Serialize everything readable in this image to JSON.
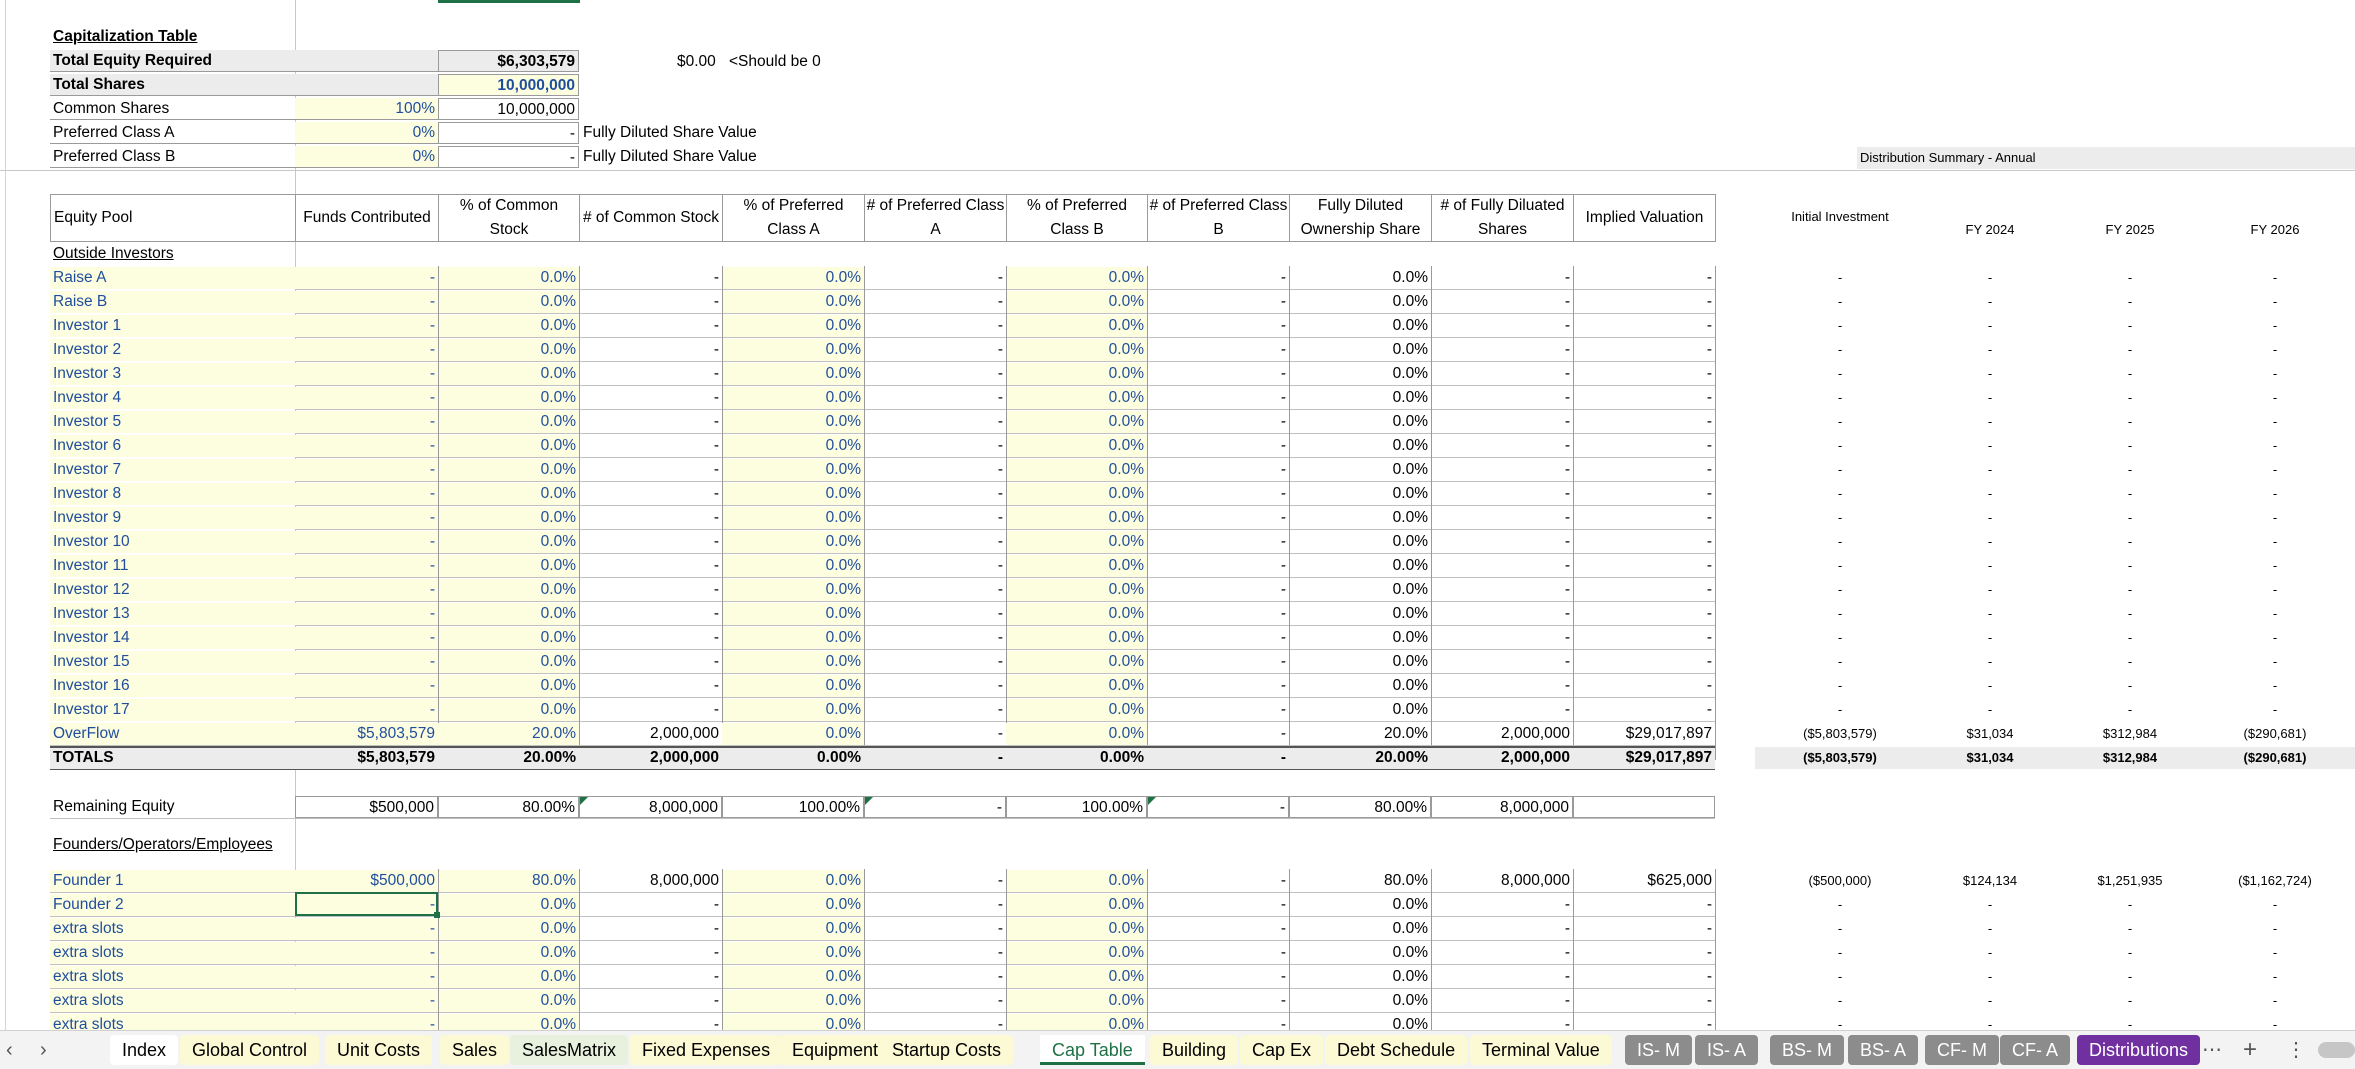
{
  "sheet": {
    "title": "Capitalization Table",
    "summary": [
      {
        "label": "Total Equity Required",
        "pct": "",
        "value": "$6,303,579",
        "note": ""
      },
      {
        "label": "Total Shares",
        "pct": "",
        "value": "10,000,000",
        "note": ""
      },
      {
        "label": "Common Shares",
        "pct": "100%",
        "value": "10,000,000",
        "note": ""
      },
      {
        "label": "Preferred Class A",
        "pct": "0%",
        "value": "-",
        "note": "Fully Diluted Share Value"
      },
      {
        "label": "Preferred Class B",
        "pct": "0%",
        "value": "-",
        "note": "Fully Diluted Share Value"
      }
    ],
    "check_value": "$0.00",
    "check_note": "<Should be 0",
    "dist_title": "Distribution Summary - Annual",
    "headers": [
      "Equity Pool",
      "Funds Contributed",
      "% of Common Stock",
      "# of Common Stock",
      "% of Preferred Class A",
      "# of Preferred Class A",
      "% of Preferred Class B",
      "# of Preferred Class B",
      "Fully Diluted Ownership Share",
      "# of Fully Diluated Shares",
      "Implied Valuation"
    ],
    "dist_headers": [
      "Initial Investment",
      "FY 2024",
      "FY 2025",
      "FY 2026"
    ],
    "outside_label": "Outside Investors",
    "investors": [
      "Raise A",
      "Raise B",
      "Investor 1",
      "Investor 2",
      "Investor 3",
      "Investor 4",
      "Investor 5",
      "Investor 6",
      "Investor 7",
      "Investor 8",
      "Investor 9",
      "Investor 10",
      "Investor 11",
      "Investor 12",
      "Investor 13",
      "Investor 14",
      "Investor 15",
      "Investor 16",
      "Investor 17"
    ],
    "investor_values": [
      "-",
      "0.0%",
      "-",
      "0.0%",
      "-",
      "0.0%",
      "-",
      "0.0%",
      "-",
      "-"
    ],
    "investor_dist": [
      "-",
      "-",
      "-",
      "-"
    ],
    "overflow": {
      "label": "OverFlow",
      "values": [
        "$5,803,579",
        "20.0%",
        "2,000,000",
        "0.0%",
        "-",
        "0.0%",
        "-",
        "20.0%",
        "2,000,000",
        "$29,017,897"
      ],
      "dist": [
        "($5,803,579)",
        "$31,034",
        "$312,984",
        "($290,681)"
      ]
    },
    "totals": {
      "label": "TOTALS",
      "values": [
        "$5,803,579",
        "20.00%",
        "2,000,000",
        "0.00%",
        "-",
        "0.00%",
        "-",
        "20.00%",
        "2,000,000",
        "$29,017,897"
      ],
      "dist": [
        "($5,803,579)",
        "$31,034",
        "$312,984",
        "($290,681)"
      ]
    },
    "remaining": {
      "label": "Remaining Equity",
      "values": [
        "$500,000",
        "80.00%",
        "8,000,000",
        "100.00%",
        "-",
        "100.00%",
        "-",
        "80.00%",
        "8,000,000",
        ""
      ]
    },
    "founders_label": "Founders/Operators/Employees",
    "founders": [
      {
        "label": "Founder 1",
        "values": [
          "$500,000",
          "80.0%",
          "8,000,000",
          "0.0%",
          "-",
          "0.0%",
          "-",
          "80.0%",
          "8,000,000",
          "$625,000"
        ],
        "dist": [
          "($500,000)",
          "$124,134",
          "$1,251,935",
          "($1,162,724)"
        ]
      },
      {
        "label": "Founder 2",
        "values": [
          "-",
          "0.0%",
          "-",
          "0.0%",
          "-",
          "0.0%",
          "-",
          "0.0%",
          "-",
          "-"
        ],
        "dist": [
          "-",
          "-",
          "-",
          "-"
        ]
      },
      {
        "label": "extra slots",
        "values": [
          "-",
          "0.0%",
          "-",
          "0.0%",
          "-",
          "0.0%",
          "-",
          "0.0%",
          "-",
          "-"
        ],
        "dist": [
          "-",
          "-",
          "-",
          "-"
        ]
      },
      {
        "label": "extra slots",
        "values": [
          "-",
          "0.0%",
          "-",
          "0.0%",
          "-",
          "0.0%",
          "-",
          "0.0%",
          "-",
          "-"
        ],
        "dist": [
          "-",
          "-",
          "-",
          "-"
        ]
      },
      {
        "label": "extra slots",
        "values": [
          "-",
          "0.0%",
          "-",
          "0.0%",
          "-",
          "0.0%",
          "-",
          "0.0%",
          "-",
          "-"
        ],
        "dist": [
          "-",
          "-",
          "-",
          "-"
        ]
      },
      {
        "label": "extra slots",
        "values": [
          "-",
          "0.0%",
          "-",
          "0.0%",
          "-",
          "0.0%",
          "-",
          "0.0%",
          "-",
          "-"
        ],
        "dist": [
          "-",
          "-",
          "-",
          "-"
        ]
      },
      {
        "label": "extra slots",
        "values": [
          "-",
          "0.0%",
          "-",
          "0.0%",
          "-",
          "0.0%",
          "-",
          "0.0%",
          "-",
          "-"
        ],
        "dist": [
          "-",
          "-",
          "-",
          "-"
        ]
      }
    ]
  },
  "tabs": [
    {
      "label": "Index",
      "style": "white"
    },
    {
      "label": "Global Control",
      "style": "yellow"
    },
    {
      "label": "Unit Costs",
      "style": "yellow"
    },
    {
      "label": "Sales",
      "style": "yellow"
    },
    {
      "label": "SalesMatrix",
      "style": "green"
    },
    {
      "label": "Fixed Expenses",
      "style": "yellow"
    },
    {
      "label": "Equipment",
      "style": "yellow"
    },
    {
      "label": "Startup Costs",
      "style": "yellow"
    },
    {
      "label": "Cap Table",
      "style": "active"
    },
    {
      "label": "Building",
      "style": "yellow"
    },
    {
      "label": "Cap Ex",
      "style": "yellow"
    },
    {
      "label": "Debt Schedule",
      "style": "yellow"
    },
    {
      "label": "Terminal Value",
      "style": "yellow"
    },
    {
      "label": "IS- M",
      "style": "gray"
    },
    {
      "label": "IS- A",
      "style": "gray"
    },
    {
      "label": "BS- M",
      "style": "gray"
    },
    {
      "label": "BS- A",
      "style": "gray"
    },
    {
      "label": "CF- M",
      "style": "gray"
    },
    {
      "label": "CF- A",
      "style": "gray"
    },
    {
      "label": "Distributions",
      "style": "purple"
    }
  ],
  "tab_controls": {
    "prev": "‹",
    "next": "›",
    "more": "⋯",
    "add": "+",
    "options": "⋮"
  },
  "colors": {
    "input_yellow": "#fdfde0",
    "input_blue": "#1f4e9c",
    "excel_green": "#1e7145",
    "tab_purple": "#7030a0",
    "tab_gray": "#8c8c8c"
  }
}
